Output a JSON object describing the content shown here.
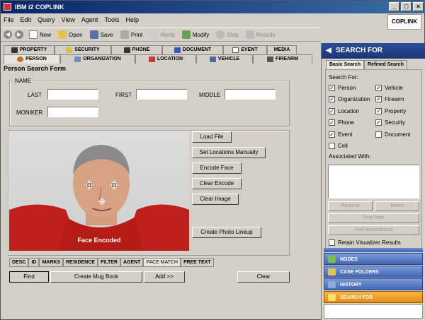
{
  "window": {
    "title": "IBM i2 COPLINK",
    "brand": "COPLINK"
  },
  "menu": [
    "File",
    "Edit",
    "Query",
    "View",
    "Agent",
    "Tools",
    "Help"
  ],
  "toolbar": [
    {
      "label": "New",
      "icon": "new-icon",
      "color": "#fff"
    },
    {
      "label": "Open",
      "icon": "open-folder-icon",
      "color": "#e8c34c"
    },
    {
      "label": "Save",
      "icon": "save-disk-icon",
      "color": "#5a6fa8"
    },
    {
      "label": "Print",
      "icon": "printer-icon",
      "color": "#aaa"
    },
    {
      "label": "Alerts",
      "icon": "alert-icon",
      "color": "#ccc",
      "disabled": true
    },
    {
      "label": "Modify",
      "icon": "modify-icon",
      "color": "#6a9f54"
    },
    {
      "label": "Stop",
      "icon": "stop-icon",
      "color": "#bbb",
      "disabled": true
    },
    {
      "label": "Results",
      "icon": "results-icon",
      "color": "#bbb",
      "disabled": true
    }
  ],
  "tabs_row1": [
    "PROPERTY",
    "SECURITY",
    "PHONE",
    "DOCUMENT",
    "EVENT",
    "MEDIA"
  ],
  "tabs_row2": [
    "PERSON",
    "ORGANIZATION",
    "LOCATION",
    "VEHICLE",
    "FIREARM"
  ],
  "form": {
    "title": "Person Search Form",
    "name_group": "NAME",
    "last_label": "LAST",
    "first_label": "FIRST",
    "middle_label": "MIDDLE",
    "moniker_label": "MONIKER",
    "last_value": "",
    "first_value": "",
    "middle_value": "",
    "moniker_value": ""
  },
  "photo": {
    "caption": "Face Encoded"
  },
  "face_buttons": [
    "Load File",
    "Set Locations Manually",
    "Encode Face",
    "Clear Encode",
    "Clear Image",
    "Create Photo Lineup"
  ],
  "bottom_tabs": [
    "DESC",
    "ID",
    "MARKS",
    "RESIDENCE",
    "FILTER",
    "AGENT",
    "FACE MATCH",
    "FREE TEXT"
  ],
  "bottom_buttons": {
    "find": "Find",
    "mugbook": "Create Mug Book",
    "add": "Add >>",
    "clear": "Clear"
  },
  "search_panel": {
    "header": "SEARCH FOR",
    "tab_basic": "Basic Search",
    "tab_refined": "Refined Search",
    "search_for_label": "Search For:",
    "options": [
      {
        "label": "Person",
        "checked": true
      },
      {
        "label": "Vehicle",
        "checked": true
      },
      {
        "label": "Organization",
        "checked": true
      },
      {
        "label": "Firearm",
        "checked": true
      },
      {
        "label": "Location",
        "checked": true
      },
      {
        "label": "Property",
        "checked": true
      },
      {
        "label": "Phone",
        "checked": true
      },
      {
        "label": "Security",
        "checked": true
      },
      {
        "label": "Event",
        "checked": true
      },
      {
        "label": "Document",
        "checked": false
      },
      {
        "label": "Cell",
        "checked": false
      }
    ],
    "associated_label": "Associated With:",
    "remove": "Remove",
    "reset": "Reset",
    "find_path": "Find Path",
    "find_associations": "Find Associations",
    "retain_label": "Retain Visualizer Results"
  },
  "accordion": [
    {
      "label": "NODES",
      "color": "#7bbf4a"
    },
    {
      "label": "CASE FOLDERS",
      "color": "#e8c34c"
    },
    {
      "label": "HISTORY",
      "color": "#8fa8e0"
    },
    {
      "label": "SEARCH FOR",
      "color": "#f2e36a",
      "active": true
    }
  ]
}
